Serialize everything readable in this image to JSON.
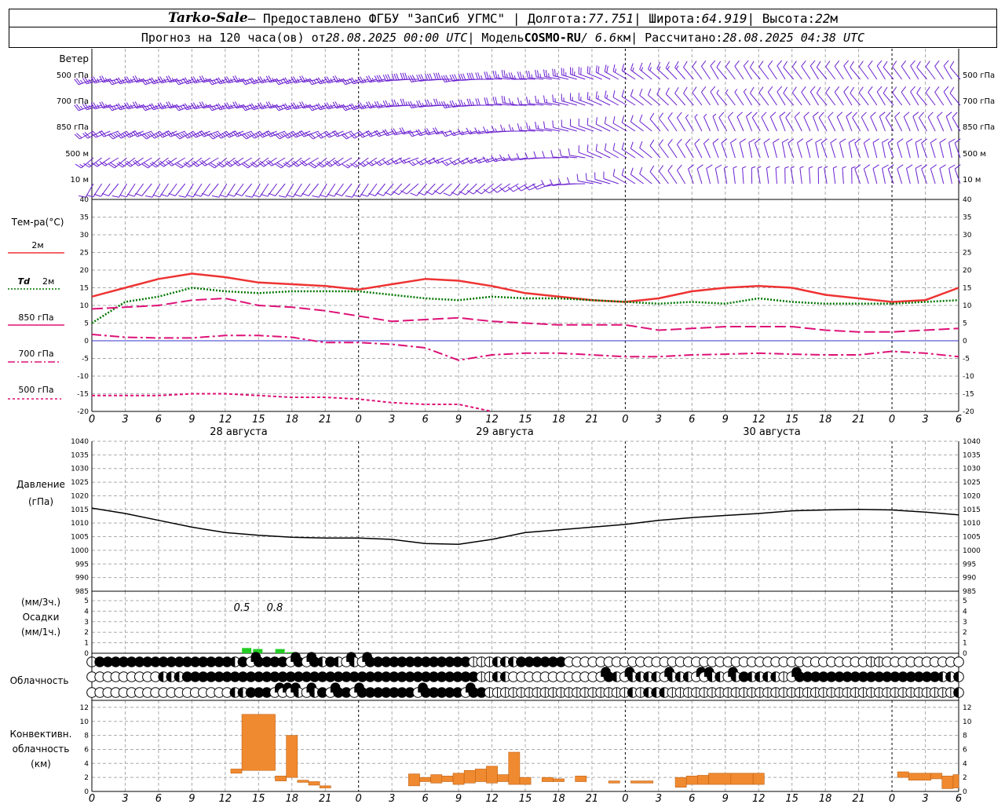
{
  "header": {
    "station": "Tarko-Sale",
    "provider": " – Предоставлено ФГБУ \"ЗапСиб УГМС\" | Долгота: ",
    "lon": "77.751",
    "lat_label": " | Широта: ",
    "lat": "64.919",
    "alt_label": " | Высота: ",
    "alt": "22",
    "alt_unit": "м",
    "line2_a": "Прогноз на 120 часа(ов) от ",
    "run": "28.08.2025 00:00 UTC",
    "line2_b": " | Модель ",
    "model": "COSMO-RU",
    "res": " / 6.6",
    "res_unit": "км",
    "line2_c": " | Рассчитано: ",
    "calc": "28.08.2025 04:38 UTC"
  },
  "labels": {
    "wind": "Ветер",
    "temp": "Тем-ра(°C)",
    "pressure_1": "Давление",
    "pressure_2": "(гПа)",
    "precip_1": "(мм/3ч.)",
    "precip_2": "Осадки",
    "precip_3": "(мм/1ч.)",
    "cloud": "Облачность",
    "conv_1": "Конвективн.",
    "conv_2": "облачность",
    "conv_3": "(км)"
  },
  "legend": {
    "t2m": "2м",
    "td_prefix": "Td",
    "td": "2м",
    "t850": "850 гПа",
    "t700": "700 гПа",
    "t500": "500 гПа"
  },
  "colors": {
    "t2m": "#ee3333",
    "td": "#007700",
    "t850": "#dd1177",
    "t700": "#dd1177",
    "t500": "#dd1177",
    "wind": "#6a1fd0",
    "precip": "#22cc22",
    "conv": "#f08a30",
    "pressure": "#000000",
    "zero_line": "#3333cc"
  },
  "chart_data": [
    {
      "type": "line",
      "title": "Ветер",
      "levels": [
        "500 гПа",
        "700 гПа",
        "850 гПа",
        "500 м",
        "10  м"
      ],
      "hours": [
        0,
        3,
        6,
        9,
        12,
        15,
        18,
        21,
        24,
        27,
        30,
        33,
        36,
        39,
        42,
        45,
        48,
        51,
        54,
        57,
        60,
        63,
        66,
        69,
        72,
        75,
        78
      ],
      "wind_speed_kt": [
        [
          25,
          25,
          25,
          25,
          25,
          25,
          25,
          25,
          25,
          30,
          30,
          30,
          25,
          25,
          25,
          20,
          15,
          15,
          10,
          10,
          10,
          10,
          10,
          10,
          10,
          10,
          10
        ],
        [
          25,
          25,
          25,
          25,
          25,
          25,
          25,
          25,
          25,
          25,
          25,
          25,
          20,
          15,
          15,
          15,
          10,
          10,
          10,
          5,
          10,
          10,
          10,
          10,
          10,
          10,
          10
        ],
        [
          20,
          25,
          25,
          25,
          25,
          25,
          25,
          20,
          20,
          20,
          20,
          15,
          15,
          15,
          10,
          10,
          10,
          10,
          5,
          10,
          10,
          10,
          10,
          10,
          10,
          10,
          10
        ],
        [
          15,
          20,
          20,
          20,
          20,
          20,
          20,
          20,
          15,
          15,
          15,
          15,
          15,
          10,
          10,
          10,
          10,
          10,
          10,
          10,
          10,
          10,
          10,
          10,
          10,
          10,
          10
        ],
        [
          10,
          10,
          10,
          10,
          10,
          10,
          10,
          10,
          10,
          10,
          10,
          10,
          10,
          10,
          10,
          10,
          10,
          10,
          10,
          5,
          5,
          5,
          5,
          10,
          10,
          10,
          10
        ]
      ],
      "wind_dir_deg": [
        [
          250,
          250,
          250,
          250,
          250,
          250,
          250,
          250,
          250,
          260,
          260,
          260,
          270,
          270,
          280,
          290,
          300,
          310,
          320,
          320,
          320,
          320,
          320,
          320,
          320,
          320,
          320
        ],
        [
          250,
          250,
          250,
          250,
          250,
          250,
          250,
          250,
          250,
          260,
          260,
          260,
          270,
          270,
          280,
          290,
          300,
          310,
          320,
          320,
          320,
          320,
          320,
          320,
          320,
          320,
          320
        ],
        [
          240,
          240,
          240,
          240,
          240,
          240,
          240,
          240,
          240,
          250,
          250,
          250,
          260,
          270,
          280,
          290,
          300,
          320,
          330,
          330,
          330,
          330,
          330,
          330,
          330,
          330,
          330
        ],
        [
          230,
          230,
          230,
          230,
          230,
          230,
          230,
          230,
          230,
          240,
          240,
          240,
          250,
          260,
          270,
          290,
          300,
          320,
          330,
          340,
          340,
          340,
          340,
          340,
          340,
          340,
          340
        ],
        [
          210,
          210,
          210,
          210,
          210,
          210,
          210,
          210,
          210,
          220,
          220,
          220,
          230,
          240,
          260,
          280,
          300,
          320,
          340,
          350,
          350,
          350,
          350,
          340,
          340,
          340,
          340
        ]
      ]
    },
    {
      "type": "line",
      "title": "Тем-ра(°C)",
      "ylim": [
        -20,
        40
      ],
      "yticks": [
        40,
        35,
        30,
        25,
        20,
        15,
        10,
        5,
        0,
        -5,
        -10,
        -15,
        -20
      ],
      "x_hours": [
        0,
        3,
        6,
        9,
        12,
        15,
        18,
        21,
        24,
        27,
        30,
        33,
        36,
        39,
        42,
        45,
        48,
        51,
        54,
        57,
        60,
        63,
        66,
        69,
        72,
        75,
        78
      ],
      "series": [
        {
          "name": "2м",
          "style": "solid",
          "values": [
            12.5,
            15,
            17.5,
            19,
            18,
            16.5,
            16,
            15.5,
            14.5,
            16,
            17.5,
            17,
            15.5,
            13.5,
            12.5,
            11.5,
            11,
            12,
            14,
            15,
            15.5,
            15,
            13,
            12,
            11,
            11.5,
            15
          ]
        },
        {
          "name": "Td 2м",
          "style": "dotted",
          "values": [
            5,
            11,
            12.5,
            15,
            14,
            13.5,
            14,
            14,
            14,
            13,
            12,
            11.5,
            12.5,
            12,
            12,
            11.5,
            11,
            10.5,
            11,
            10.5,
            12,
            11,
            10.5,
            10.5,
            10.5,
            11,
            11.5
          ]
        },
        {
          "name": "850 гПа",
          "style": "dashed",
          "values": [
            9,
            9.5,
            10,
            11.5,
            12,
            10,
            9.5,
            8.5,
            7,
            5.5,
            6,
            6.5,
            5.5,
            5,
            4.5,
            4.5,
            4.5,
            3,
            3.5,
            4,
            4,
            4,
            3,
            2.5,
            2.5,
            3,
            3.5
          ]
        },
        {
          "name": "700 гПа",
          "style": "dashdot",
          "values": [
            1.8,
            1,
            0.8,
            0.8,
            1.5,
            1.5,
            1,
            -0.5,
            -0.5,
            -1,
            -2,
            -5.5,
            -4,
            -3.5,
            -3.5,
            -4,
            -4.5,
            -4.5,
            -4,
            -3.8,
            -3.5,
            -3.8,
            -4,
            -4,
            -3,
            -3.5,
            -4.5
          ]
        },
        {
          "name": "500 гПа",
          "style": "dotted",
          "values": [
            -15.5,
            -15.5,
            -15.5,
            -15,
            -15,
            -15.5,
            -16,
            -16,
            -16.5,
            -17.5,
            -18,
            -18,
            -20
          ]
        }
      ]
    },
    {
      "type": "line",
      "title": "Давление",
      "ylim": [
        985,
        1040
      ],
      "yticks": [
        1040,
        1035,
        1030,
        1025,
        1020,
        1015,
        1010,
        1005,
        1000,
        995,
        990,
        985
      ],
      "x_hours": [
        0,
        3,
        6,
        9,
        12,
        15,
        18,
        21,
        24,
        27,
        30,
        33,
        36,
        39,
        42,
        45,
        48,
        51,
        54,
        57,
        60,
        63,
        66,
        69,
        72,
        75,
        78
      ],
      "series": [
        {
          "name": "Давление",
          "values": [
            1015.5,
            1013.5,
            1011,
            1008.5,
            1006.5,
            1005.5,
            1004.8,
            1004.5,
            1004.5,
            1004,
            1002.5,
            1002.2,
            1004,
            1006.5,
            1007.5,
            1008.5,
            1009.5,
            1011,
            1012,
            1012.8,
            1013.5,
            1014.5,
            1014.8,
            1015,
            1014.8,
            1014,
            1013
          ]
        }
      ]
    },
    {
      "type": "bar",
      "title": "Осадки",
      "ylim": [
        0,
        5
      ],
      "yticks": [
        5,
        4,
        3,
        2,
        1,
        0
      ],
      "annotations": [
        "0.5",
        "0.8"
      ],
      "bars_mm": [
        {
          "h": 14,
          "v": 0.5
        },
        {
          "h": 15,
          "v": 0.4
        },
        {
          "h": 17,
          "v": 0.4
        },
        {
          "h": 18,
          "v": 0.1
        }
      ]
    },
    {
      "type": "bar",
      "title": "Конвективн. облачность (км)",
      "ylim": [
        0,
        13
      ],
      "yticks": [
        12,
        10,
        8,
        6,
        4,
        2,
        0
      ],
      "segments_km": [
        {
          "h0": 12.5,
          "h1": 13.5,
          "bot": 2.6,
          "top": 3.2
        },
        {
          "h0": 13.5,
          "h1": 16.5,
          "bot": 3.0,
          "top": 11.0
        },
        {
          "h0": 16.5,
          "h1": 17.5,
          "bot": 1.5,
          "top": 2.2
        },
        {
          "h0": 17.5,
          "h1": 18.5,
          "bot": 2.0,
          "top": 8.0
        },
        {
          "h0": 18.5,
          "h1": 19.5,
          "bot": 1.3,
          "top": 1.6
        },
        {
          "h0": 19.5,
          "h1": 20.5,
          "bot": 0.9,
          "top": 1.4
        },
        {
          "h0": 20.5,
          "h1": 21.5,
          "bot": 0.5,
          "top": 0.8
        },
        {
          "h0": 28.5,
          "h1": 29.5,
          "bot": 0.8,
          "top": 2.5
        },
        {
          "h0": 29.5,
          "h1": 30.5,
          "bot": 1.4,
          "top": 2.0
        },
        {
          "h0": 30.5,
          "h1": 31.5,
          "bot": 1.2,
          "top": 2.4
        },
        {
          "h0": 31.5,
          "h1": 32.5,
          "bot": 1.4,
          "top": 2.2
        },
        {
          "h0": 32.5,
          "h1": 33.5,
          "bot": 1.0,
          "top": 2.6
        },
        {
          "h0": 33.5,
          "h1": 34.5,
          "bot": 1.2,
          "top": 3.0
        },
        {
          "h0": 34.5,
          "h1": 35.5,
          "bot": 1.4,
          "top": 3.2
        },
        {
          "h0": 35.5,
          "h1": 36.5,
          "bot": 1.2,
          "top": 3.6
        },
        {
          "h0": 36.5,
          "h1": 37.5,
          "bot": 1.4,
          "top": 2.4
        },
        {
          "h0": 37.5,
          "h1": 38.5,
          "bot": 1.0,
          "top": 5.6
        },
        {
          "h0": 38.5,
          "h1": 39.5,
          "bot": 1.0,
          "top": 2.0
        },
        {
          "h0": 40.5,
          "h1": 41.5,
          "bot": 1.4,
          "top": 2.0
        },
        {
          "h0": 41.5,
          "h1": 42.5,
          "bot": 1.4,
          "top": 1.8
        },
        {
          "h0": 43.5,
          "h1": 44.5,
          "bot": 1.4,
          "top": 2.2
        },
        {
          "h0": 46.5,
          "h1": 47.5,
          "bot": 1.2,
          "top": 1.5
        },
        {
          "h0": 48.5,
          "h1": 50.5,
          "bot": 1.2,
          "top": 1.5
        },
        {
          "h0": 52.5,
          "h1": 53.5,
          "bot": 0.6,
          "top": 2.0
        },
        {
          "h0": 53.5,
          "h1": 54.5,
          "bot": 1.0,
          "top": 2.2
        },
        {
          "h0": 54.5,
          "h1": 55.5,
          "bot": 1.0,
          "top": 2.3
        },
        {
          "h0": 55.5,
          "h1": 57.5,
          "bot": 1.0,
          "top": 2.6
        },
        {
          "h0": 57.5,
          "h1": 59.5,
          "bot": 1.0,
          "top": 2.6
        },
        {
          "h0": 59.5,
          "h1": 60.5,
          "bot": 1.0,
          "top": 2.6
        },
        {
          "h0": 72.5,
          "h1": 73.5,
          "bot": 2.0,
          "top": 2.8
        },
        {
          "h0": 73.5,
          "h1": 75.5,
          "bot": 1.6,
          "top": 2.6
        },
        {
          "h0": 75.5,
          "h1": 76.5,
          "bot": 1.8,
          "top": 2.6
        },
        {
          "h0": 76.5,
          "h1": 77.5,
          "bot": 0.4,
          "top": 2.2
        },
        {
          "h0": 77.5,
          "h1": 78,
          "bot": 0.5,
          "top": 2.4
        }
      ]
    },
    {
      "type": "table",
      "title": "Облачность",
      "rows_tenths_0_to_4": [
        [
          1,
          4,
          4,
          4,
          4,
          4,
          4,
          4,
          4,
          4,
          4,
          4,
          4,
          4,
          4,
          4,
          4,
          4,
          2,
          4,
          3,
          4,
          4,
          4,
          4,
          3,
          4,
          3,
          4,
          2,
          4,
          2,
          3,
          2,
          3,
          4,
          4,
          4,
          4,
          4,
          4,
          4,
          4,
          4,
          4,
          4,
          4,
          4,
          1,
          1,
          1,
          2,
          2,
          2,
          4,
          4,
          4,
          4,
          4,
          4,
          0,
          0,
          0,
          0,
          0,
          0,
          0,
          0,
          0,
          0,
          0,
          0,
          0,
          0,
          0,
          0,
          0,
          0,
          0,
          0,
          0,
          0,
          0,
          0,
          0,
          0,
          0,
          0,
          0,
          0,
          0,
          0,
          0,
          0,
          0,
          0,
          0,
          0,
          1,
          1,
          0,
          0,
          0,
          0,
          0,
          0,
          0,
          0,
          0,
          0
        ],
        [
          0,
          0,
          0,
          0,
          0,
          0,
          0,
          0,
          0,
          2,
          2,
          2,
          4,
          4,
          4,
          4,
          4,
          4,
          4,
          4,
          4,
          4,
          4,
          4,
          4,
          4,
          4,
          4,
          4,
          4,
          4,
          4,
          4,
          4,
          4,
          4,
          4,
          4,
          4,
          4,
          4,
          4,
          4,
          4,
          4,
          4,
          4,
          4,
          4,
          1,
          1,
          2,
          2,
          0,
          0,
          0,
          0,
          0,
          0,
          0,
          0,
          0,
          0,
          0,
          3,
          4,
          2,
          3,
          2,
          2,
          2,
          2,
          3,
          2,
          2,
          2,
          3,
          3,
          2,
          2,
          3,
          2,
          4,
          2,
          2,
          2,
          2,
          1,
          3,
          4,
          4,
          4,
          4,
          4,
          4,
          4,
          4,
          4,
          4,
          4,
          4,
          4,
          4,
          4,
          4,
          4,
          4,
          2,
          2,
          2
        ],
        [
          0,
          0,
          0,
          0,
          0,
          0,
          0,
          0,
          0,
          0,
          0,
          0,
          0,
          0,
          0,
          0,
          0,
          0,
          2,
          2,
          4,
          4,
          4,
          3,
          3,
          3,
          2,
          3,
          2,
          4,
          3,
          4,
          4,
          3,
          4,
          4,
          4,
          4,
          4,
          4,
          4,
          3,
          4,
          4,
          4,
          4,
          4,
          3,
          4,
          4,
          1,
          1,
          1,
          1,
          1,
          1,
          1,
          1,
          1,
          1,
          1,
          1,
          1,
          1,
          1,
          1,
          1,
          1,
          2,
          1,
          2,
          2,
          2,
          1,
          1,
          1,
          1,
          1,
          1,
          1,
          1,
          1,
          1,
          1,
          1,
          1,
          1,
          1,
          1,
          1,
          1,
          1,
          1,
          1,
          1,
          1,
          1,
          1,
          1,
          1,
          1,
          1,
          1,
          1,
          1,
          1,
          1,
          1,
          1,
          2
        ]
      ]
    }
  ],
  "axis": {
    "hour_labels": [
      "0",
      "3",
      "6",
      "9",
      "12",
      "15",
      "18",
      "21",
      "0",
      "3",
      "6",
      "9",
      "12",
      "15",
      "18",
      "21",
      "0",
      "3",
      "6",
      "9",
      "12",
      "15",
      "18",
      "21",
      "0",
      "3",
      "6"
    ],
    "dates": [
      "28 августа",
      "29 августа",
      "30 августа"
    ],
    "precip_values": [
      "0.5",
      "0.8"
    ]
  }
}
